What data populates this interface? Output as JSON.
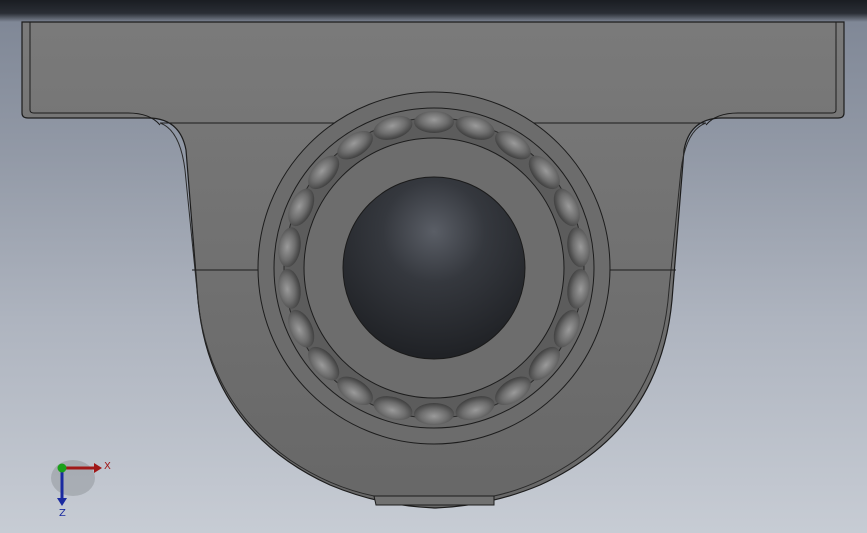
{
  "viewport": {
    "background_top": "#7d8594",
    "background_bottom": "#c7ccd4"
  },
  "model": {
    "body_color": "#6a6a6a",
    "edge_color": "#1c1c1c",
    "bore_color": "#2a2c30",
    "ball_count": 22
  },
  "triad": {
    "x_label": "X",
    "z_label": "Z",
    "x_color": "#a01818",
    "y_color": "#1aa01a",
    "z_color": "#1a2aa0"
  }
}
